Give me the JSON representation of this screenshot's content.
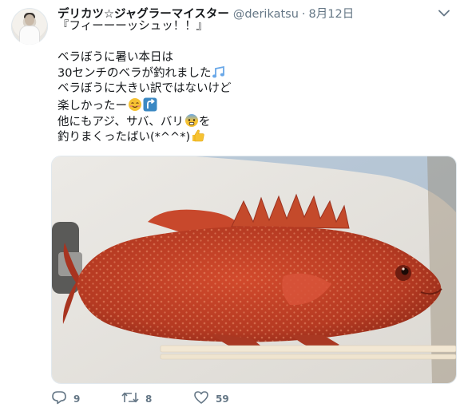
{
  "tweet": {
    "author_name": "デリカツ☆ジャグラーマイスター",
    "author_handle": "@derikatsu",
    "separator": "·",
    "date": "8月12日",
    "lines": [
      "『フィーーーッシュッ！！』",
      "",
      "ベラぼうに暑い本日は",
      "30センチのベラが釣れました",
      "ベラぼうに大きい訳ではないけど",
      "楽しかったー",
      "他にもアジ、サバ、バリ",
      "を",
      "釣りまくったばい(*^^*)"
    ]
  },
  "actions": {
    "reply_count": "9",
    "retweet_count": "8",
    "like_count": "59"
  },
  "icons": {
    "reply": "reply-icon",
    "retweet": "retweet-icon",
    "like": "heart-icon",
    "menu": "chevron-down-icon"
  },
  "colors": {
    "text": "#14171a",
    "muted": "#657786",
    "fish": "#c2412a"
  }
}
